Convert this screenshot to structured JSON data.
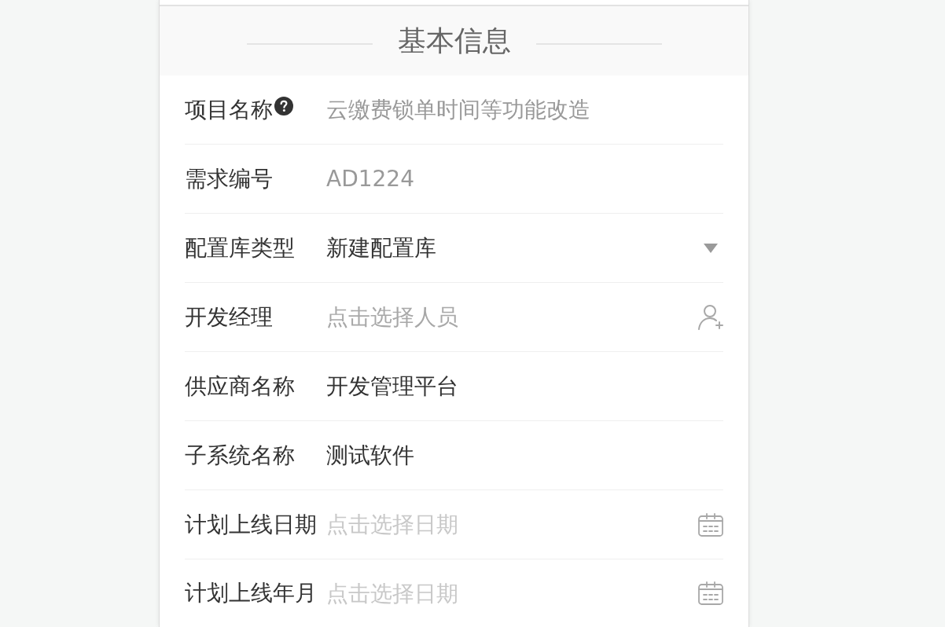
{
  "section": {
    "title": "基本信息"
  },
  "fields": [
    {
      "label": "项目名称",
      "help": true,
      "kind": "text",
      "value": "云缴费锁单时间等功能改造",
      "disabled": true
    },
    {
      "label": "需求编号",
      "help": false,
      "kind": "text",
      "value": "AD1224",
      "disabled": true
    },
    {
      "label": "配置库类型",
      "help": false,
      "kind": "select",
      "value": "新建配置库",
      "disabled": false
    },
    {
      "label": "开发经理",
      "help": false,
      "kind": "person",
      "placeholder": "点击选择人员",
      "disabled": false
    },
    {
      "label": "供应商名称",
      "help": false,
      "kind": "text",
      "value": "开发管理平台",
      "disabled": false
    },
    {
      "label": "子系统名称",
      "help": false,
      "kind": "text",
      "value": "测试软件",
      "disabled": false
    },
    {
      "label": "计划上线日期",
      "help": false,
      "kind": "date",
      "placeholder": "点击选择日期",
      "disabled": false
    },
    {
      "label": "计划上线年月",
      "help": false,
      "kind": "date",
      "placeholder": "点击选择日期",
      "disabled": false
    }
  ]
}
